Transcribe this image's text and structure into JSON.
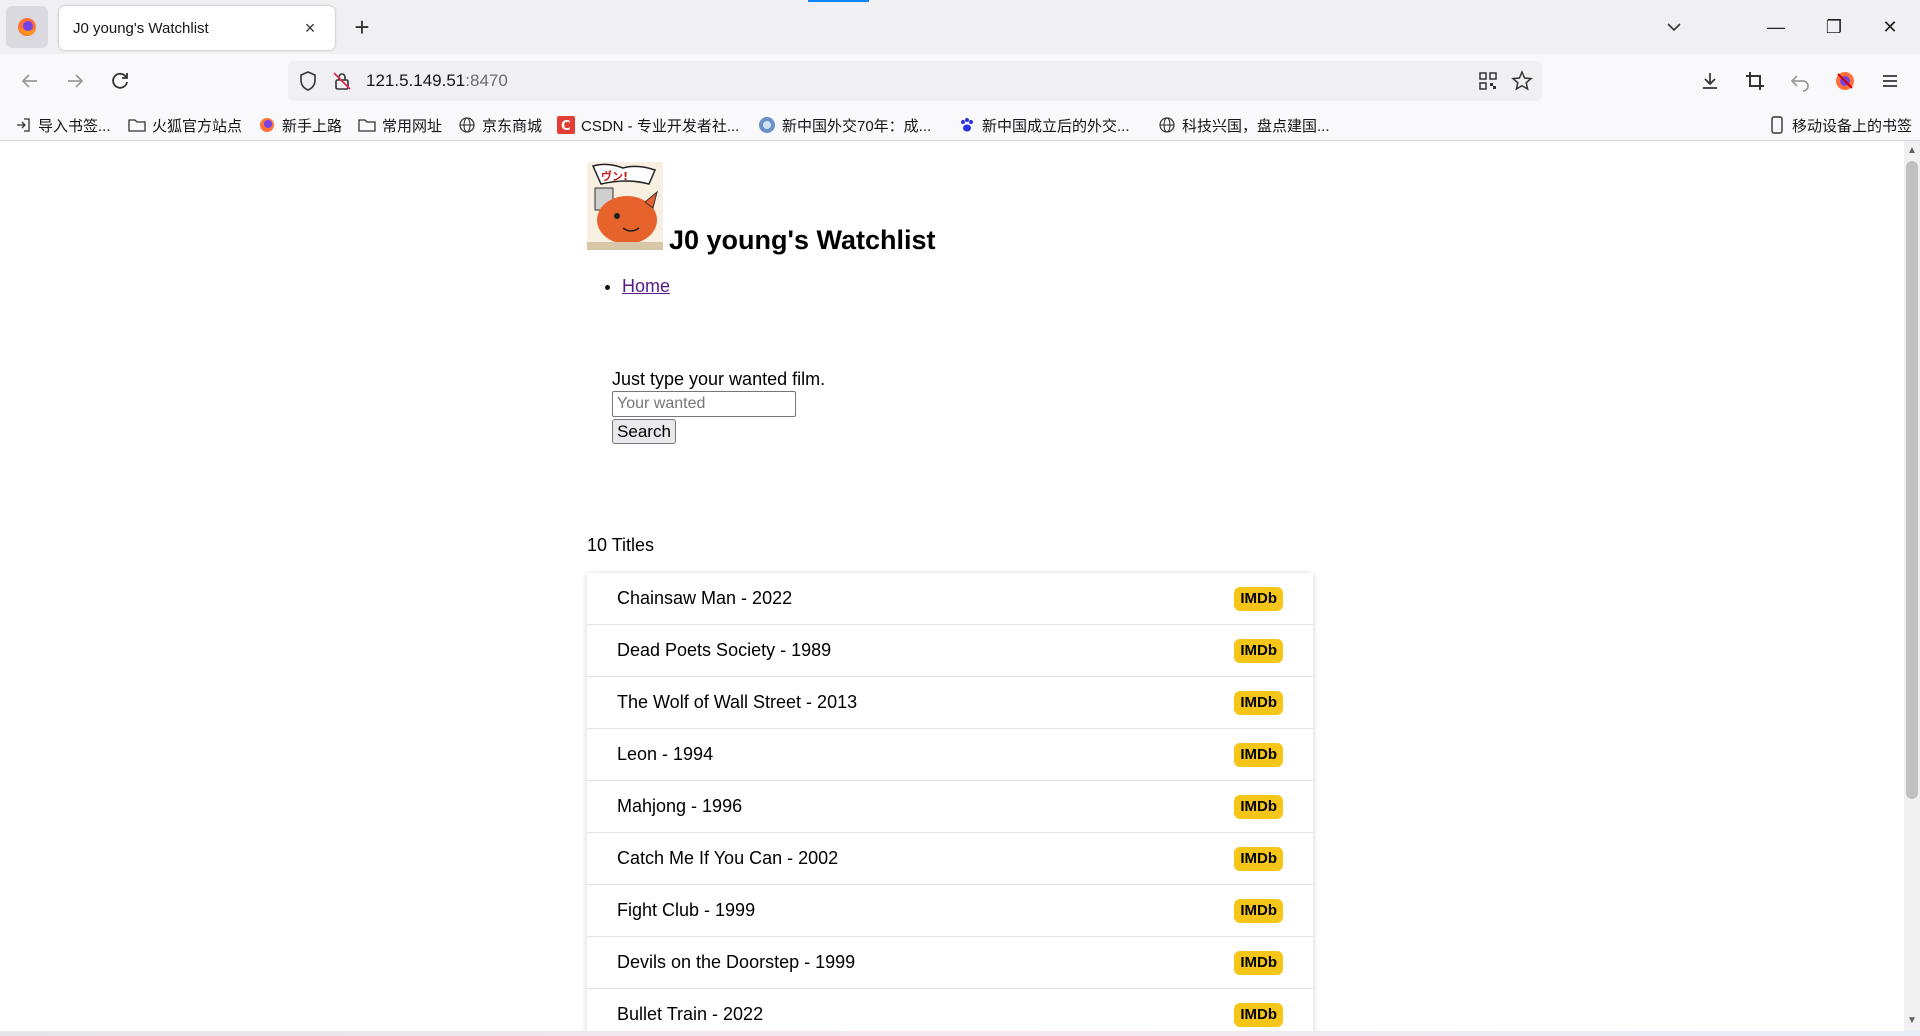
{
  "browser": {
    "tab_title": "J0 young's Watchlist",
    "tab_close": "×",
    "new_tab": "+",
    "url_host": "121.5.149.51",
    "url_port": ":8470",
    "window_controls": {
      "minimize": "—",
      "restore": "❐",
      "close": "✕"
    },
    "bookmarks": [
      {
        "label": "导入书签...",
        "icon": "import-icon"
      },
      {
        "label": "火狐官方站点",
        "icon": "folder-icon"
      },
      {
        "label": "新手上路",
        "icon": "firefox-icon"
      },
      {
        "label": "常用网址",
        "icon": "folder-icon"
      },
      {
        "label": "京东商城",
        "icon": "globe-icon"
      },
      {
        "label": "CSDN - 专业开发者社...",
        "icon": "csdn-icon"
      },
      {
        "label": "新中国外交70年：成...",
        "icon": "site-icon"
      },
      {
        "label": "新中国成立后的外交...",
        "icon": "paw-icon"
      },
      {
        "label": "科技兴国，盘点建国...",
        "icon": "globe-icon"
      }
    ],
    "mobile_bookmarks": "移动设备上的书签"
  },
  "page": {
    "site_title": "J0 young's Watchlist",
    "nav": [
      {
        "label": "Home"
      }
    ],
    "search": {
      "label": "Just type your wanted film.",
      "placeholder": "Your wanted",
      "button": "Search"
    },
    "count_text": "10 Titles",
    "movies": [
      {
        "title": "Chainsaw Man - 2022",
        "badge": "IMDb"
      },
      {
        "title": "Dead Poets Society - 1989",
        "badge": "IMDb"
      },
      {
        "title": "The Wolf of Wall Street - 2013",
        "badge": "IMDb"
      },
      {
        "title": "Leon - 1994",
        "badge": "IMDb"
      },
      {
        "title": "Mahjong - 1996",
        "badge": "IMDb"
      },
      {
        "title": "Catch Me If You Can - 2002",
        "badge": "IMDb"
      },
      {
        "title": "Fight Club - 1999",
        "badge": "IMDb"
      },
      {
        "title": "Devils on the Doorstep - 1999",
        "badge": "IMDb"
      },
      {
        "title": "Bullet Train - 2022",
        "badge": "IMDb"
      }
    ],
    "colors": {
      "imdb_badge": "#f5c518",
      "link_visited": "#551a8b"
    }
  }
}
